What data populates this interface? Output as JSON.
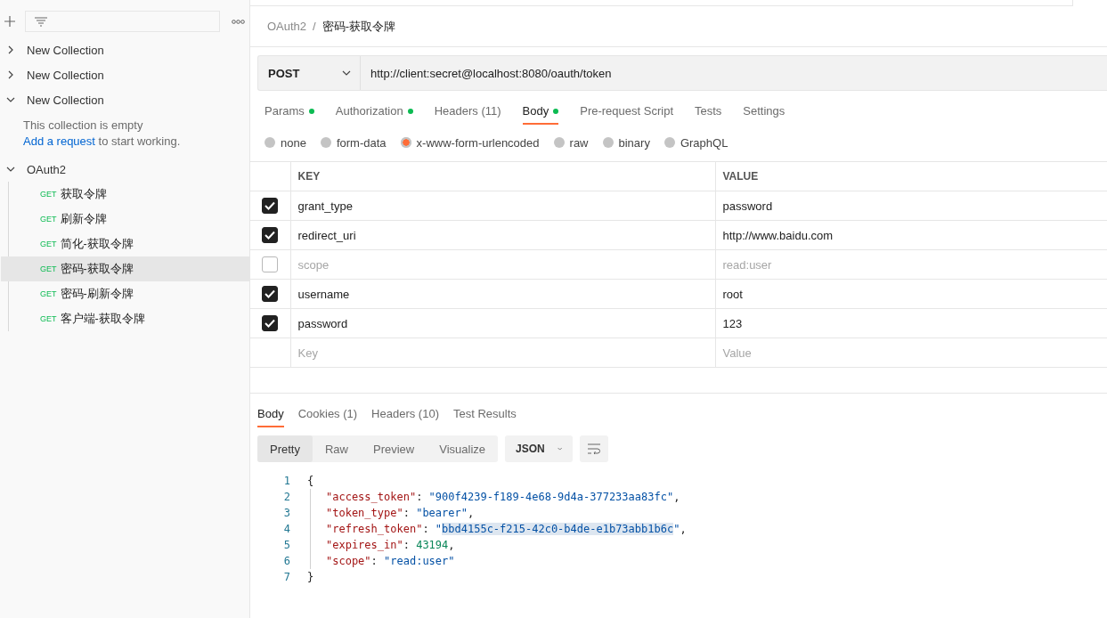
{
  "sidebar": {
    "collections": [
      {
        "name": "New Collection",
        "expanded": false
      },
      {
        "name": "New Collection",
        "expanded": false
      },
      {
        "name": "New Collection",
        "expanded": true,
        "empty_message": "This collection is empty",
        "hint": {
          "link": "Add a request",
          "rest": " to start working."
        }
      },
      {
        "name": "OAuth2",
        "expanded": true,
        "children": [
          {
            "method": "GET",
            "name": "获取令牌",
            "selected": false
          },
          {
            "method": "GET",
            "name": "刷新令牌",
            "selected": false
          },
          {
            "method": "GET",
            "name": "简化-获取令牌",
            "selected": false
          },
          {
            "method": "GET",
            "name": "密码-获取令牌",
            "selected": true
          },
          {
            "method": "GET",
            "name": "密码-刷新令牌",
            "selected": false
          },
          {
            "method": "GET",
            "name": "客户端-获取令牌",
            "selected": false
          }
        ]
      }
    ]
  },
  "breadcrumb": {
    "parent": "OAuth2",
    "separator": "/",
    "current": "密码-获取令牌"
  },
  "request": {
    "method": "POST",
    "url": "http://client:secret@localhost:8080/oauth/token"
  },
  "request_tabs": [
    {
      "label": "Params",
      "dot": true,
      "selected": false
    },
    {
      "label": "Authorization",
      "dot": true,
      "selected": false
    },
    {
      "label": "Headers (11)",
      "dot": false,
      "selected": false
    },
    {
      "label": "Body",
      "dot": true,
      "selected": true
    },
    {
      "label": "Pre-request Script",
      "dot": false,
      "selected": false
    },
    {
      "label": "Tests",
      "dot": false,
      "selected": false
    },
    {
      "label": "Settings",
      "dot": false,
      "selected": false
    }
  ],
  "body_types": [
    {
      "label": "none",
      "selected": false
    },
    {
      "label": "form-data",
      "selected": false
    },
    {
      "label": "x-www-form-urlencoded",
      "selected": true
    },
    {
      "label": "raw",
      "selected": false
    },
    {
      "label": "binary",
      "selected": false
    },
    {
      "label": "GraphQL",
      "selected": false
    }
  ],
  "params_table": {
    "columns": [
      "KEY",
      "VALUE"
    ],
    "rows": [
      {
        "checked": true,
        "key": "grant_type",
        "value": "password"
      },
      {
        "checked": true,
        "key": "redirect_uri",
        "value": "http://www.baidu.com"
      },
      {
        "checked": false,
        "key": "scope",
        "value": "read:user"
      },
      {
        "checked": true,
        "key": "username",
        "value": "root"
      },
      {
        "checked": true,
        "key": "password",
        "value": "123"
      }
    ],
    "new_row": {
      "key_placeholder": "Key",
      "value_placeholder": "Value"
    }
  },
  "response_tabs": [
    {
      "label": "Body",
      "selected": true
    },
    {
      "label": "Cookies (1)",
      "selected": false
    },
    {
      "label": "Headers (10)",
      "selected": false
    },
    {
      "label": "Test Results",
      "selected": false
    }
  ],
  "view_modes": [
    {
      "label": "Pretty",
      "selected": true
    },
    {
      "label": "Raw",
      "selected": false
    },
    {
      "label": "Preview",
      "selected": false
    },
    {
      "label": "Visualize",
      "selected": false
    }
  ],
  "format": "JSON",
  "code": {
    "line_numbers": [
      "1",
      "2",
      "3",
      "4",
      "5",
      "6",
      "7"
    ],
    "open": "{",
    "close": "}",
    "entries": [
      [
        {
          "kind": "key",
          "text": "\"access_token\""
        },
        {
          "kind": "punct",
          "text": ": "
        },
        {
          "kind": "string",
          "text": "\"900f4239-f189-4e68-9d4a-377233aa83fc\""
        },
        {
          "kind": "punct",
          "text": ","
        }
      ],
      [
        {
          "kind": "key",
          "text": "\"token_type\""
        },
        {
          "kind": "punct",
          "text": ": "
        },
        {
          "kind": "string",
          "text": "\"bearer\""
        },
        {
          "kind": "punct",
          "text": ","
        }
      ],
      [
        {
          "kind": "key",
          "text": "\"refresh_token\""
        },
        {
          "kind": "punct",
          "text": ": "
        },
        {
          "kind": "string",
          "text": "\""
        },
        {
          "kind": "selection",
          "text": "bbd4155c-f215-42c0-b4de-e1b73abb1b6c"
        },
        {
          "kind": "string",
          "text": "\""
        },
        {
          "kind": "punct",
          "text": ","
        }
      ],
      [
        {
          "kind": "key",
          "text": "\"expires_in\""
        },
        {
          "kind": "punct",
          "text": ": "
        },
        {
          "kind": "number",
          "text": "43194"
        },
        {
          "kind": "punct",
          "text": ","
        }
      ],
      [
        {
          "kind": "key",
          "text": "\"scope\""
        },
        {
          "kind": "punct",
          "text": ": "
        },
        {
          "kind": "string",
          "text": "\"read:user\""
        }
      ]
    ]
  }
}
